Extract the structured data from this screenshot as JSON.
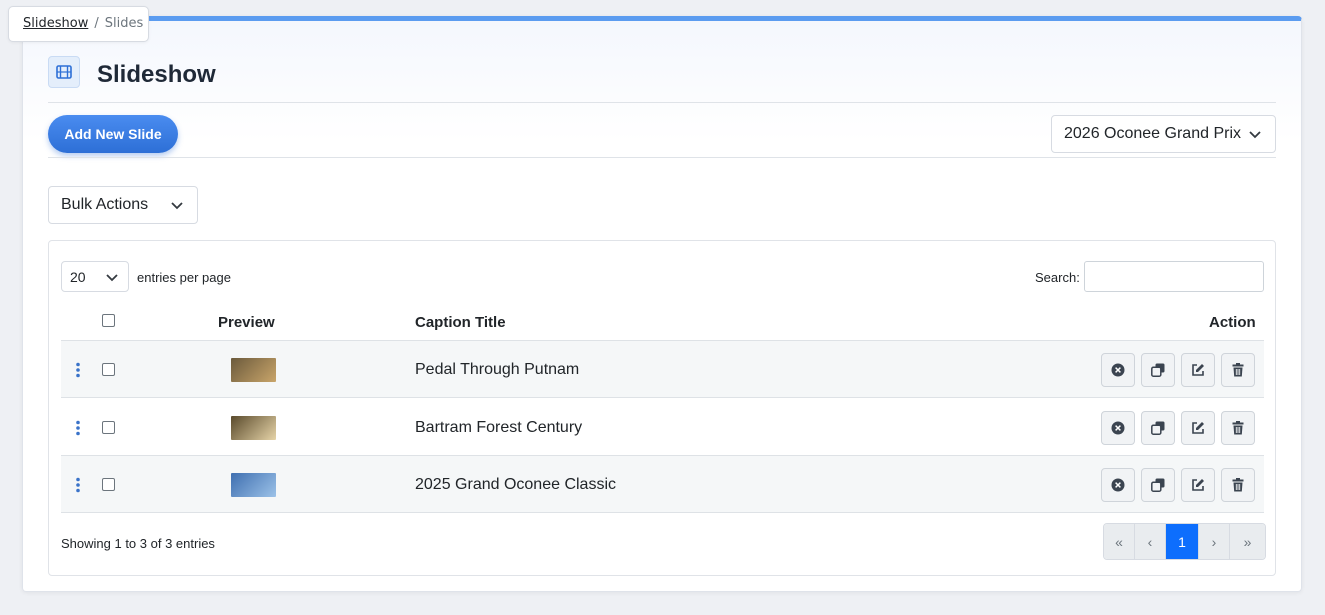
{
  "breadcrumb": {
    "root": "Slideshow",
    "separator": "/",
    "current": "Slides"
  },
  "page": {
    "title": "Slideshow",
    "title_icon": "film-icon"
  },
  "toolbar": {
    "add_button": "Add New Slide",
    "event_select_value": "2026 Oconee Grand Prix"
  },
  "bulk_actions": {
    "label": "Bulk Actions"
  },
  "table": {
    "length_value": "20",
    "length_label": "entries per page",
    "search_label": "Search:",
    "search_value": "",
    "columns": {
      "preview": "Preview",
      "caption": "Caption Title",
      "action": "Action"
    },
    "rows": [
      {
        "caption": "Pedal Through Putnam",
        "thumb_colors": [
          "#6b5a3c",
          "#c9a56a"
        ]
      },
      {
        "caption": "Bartram Forest Century",
        "thumb_colors": [
          "#5a4a2c",
          "#e6d4a8"
        ]
      },
      {
        "caption": "2025 Grand Oconee Classic",
        "thumb_colors": [
          "#3f6fb0",
          "#9cc2e8"
        ]
      }
    ],
    "row_actions": [
      "close-circle-icon",
      "duplicate-icon",
      "edit-icon",
      "trash-icon"
    ],
    "info": "Showing 1 to 3 of 3 entries",
    "pagination": {
      "first": "«",
      "prev": "‹",
      "current": "1",
      "next": "›",
      "last": "»"
    }
  },
  "colors": {
    "accent": "#2d6fd6",
    "active_page": "#0d6efd",
    "top_border": "#5b9cf0"
  }
}
